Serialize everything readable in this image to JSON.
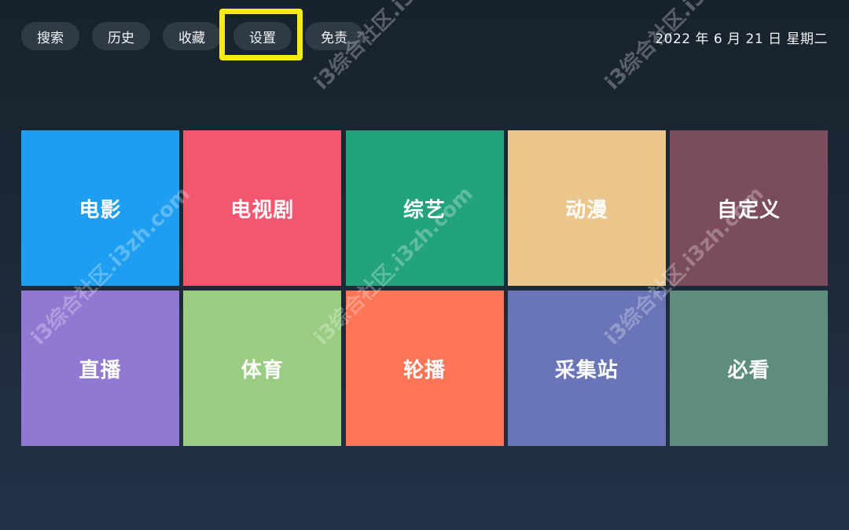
{
  "nav": {
    "items": [
      {
        "label": "搜索"
      },
      {
        "label": "历史"
      },
      {
        "label": "收藏"
      },
      {
        "label": "设置"
      },
      {
        "label": "免责"
      }
    ]
  },
  "date_text": "2022 年 6 月 21 日 星期二",
  "tiles": [
    {
      "label": "电影",
      "color": "#1e9ef0"
    },
    {
      "label": "电视剧",
      "color": "#f5566f"
    },
    {
      "label": "综艺",
      "color": "#22a37c"
    },
    {
      "label": "动漫",
      "color": "#ebc68d"
    },
    {
      "label": "自定义",
      "color": "#7b4c5e"
    },
    {
      "label": "直播",
      "color": "#9178d2"
    },
    {
      "label": "体育",
      "color": "#9acc82"
    },
    {
      "label": "轮播",
      "color": "#fc7556"
    },
    {
      "label": "采集站",
      "color": "#6a75b8"
    },
    {
      "label": "必看",
      "color": "#5e8d7e"
    }
  ],
  "highlight_color": "#f5ea11",
  "watermark_text": "i3综合社区.i3zh.com"
}
